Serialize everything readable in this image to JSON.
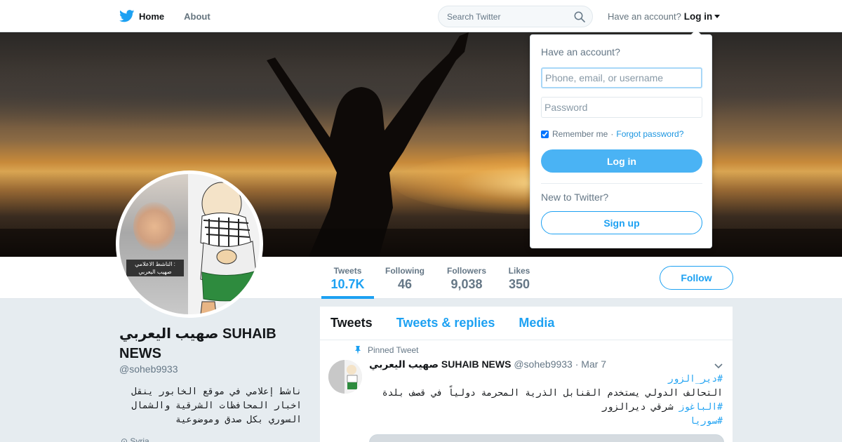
{
  "nav": {
    "home_label": "Home",
    "about_label": "About",
    "logo_icon": "twitter-bird-icon"
  },
  "search": {
    "placeholder": "Search Twitter",
    "icon": "search-icon"
  },
  "account": {
    "prompt": "Have an account?",
    "login_label": "Log in"
  },
  "profile": {
    "name": "صهيب اليعربي SUHAIB NEWS",
    "handle": "@soheb9933",
    "bio": "ناشط إعلامي في موقع الخابور ينقل اخبار المحافظات الشرقية والشمال السوري بكل صدق وموضوعية",
    "location": "Syria",
    "avatar_caption_line1": "الناشط الاعلامي :",
    "avatar_caption_line2": "صهيب اليعربي"
  },
  "stats": [
    {
      "label": "Tweets",
      "value": "10.7K"
    },
    {
      "label": "Following",
      "value": "46"
    },
    {
      "label": "Followers",
      "value": "9,038"
    },
    {
      "label": "Likes",
      "value": "350"
    }
  ],
  "follow_label": "Follow",
  "timeline": {
    "tabs": [
      "Tweets",
      "Tweets & replies",
      "Media"
    ],
    "pinned_label": "Pinned Tweet",
    "tweet": {
      "name": "صهيب اليعربي SUHAIB NEWS",
      "handle": "@soheb9933",
      "date": "· Mar 7",
      "hashtag1": "#دير_الزور",
      "line1": "التحالف الدولي يستخدم القنابل الذرية المحرمة دولياً في قصف بلدة",
      "hashtag2": "#الباغوز",
      "line2": " شرقي ديرالزور",
      "hashtag3": "#سوريا"
    }
  },
  "login_dropdown": {
    "title": "Have an account?",
    "username_placeholder": "Phone, email, or username",
    "password_placeholder": "Password",
    "remember_label": "Remember me",
    "separator": "·",
    "forgot_label": "Forgot password?",
    "login_button": "Log in",
    "new_prompt": "New to Twitter?",
    "signup_button": "Sign up"
  },
  "colors": {
    "accent": "#1da1f2",
    "login_button": "#4ab3f4"
  }
}
